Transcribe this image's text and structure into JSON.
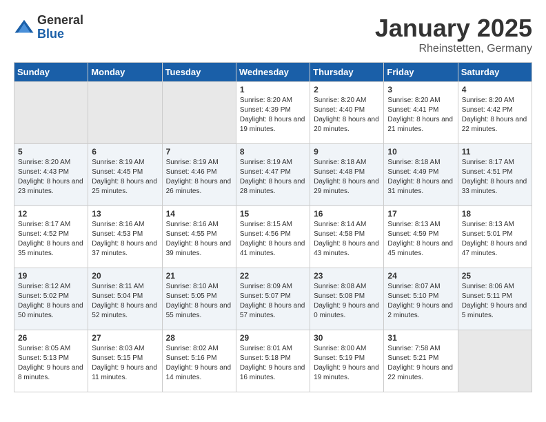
{
  "logo": {
    "general": "General",
    "blue": "Blue"
  },
  "header": {
    "title": "January 2025",
    "subtitle": "Rheinstetten, Germany"
  },
  "days_of_week": [
    "Sunday",
    "Monday",
    "Tuesday",
    "Wednesday",
    "Thursday",
    "Friday",
    "Saturday"
  ],
  "weeks": [
    [
      {
        "day": "",
        "empty": true
      },
      {
        "day": "",
        "empty": true
      },
      {
        "day": "",
        "empty": true
      },
      {
        "day": "1",
        "sunrise": "8:20 AM",
        "sunset": "4:39 PM",
        "daylight": "8 hours and 19 minutes."
      },
      {
        "day": "2",
        "sunrise": "8:20 AM",
        "sunset": "4:40 PM",
        "daylight": "8 hours and 20 minutes."
      },
      {
        "day": "3",
        "sunrise": "8:20 AM",
        "sunset": "4:41 PM",
        "daylight": "8 hours and 21 minutes."
      },
      {
        "day": "4",
        "sunrise": "8:20 AM",
        "sunset": "4:42 PM",
        "daylight": "8 hours and 22 minutes."
      }
    ],
    [
      {
        "day": "5",
        "sunrise": "8:20 AM",
        "sunset": "4:43 PM",
        "daylight": "8 hours and 23 minutes."
      },
      {
        "day": "6",
        "sunrise": "8:19 AM",
        "sunset": "4:45 PM",
        "daylight": "8 hours and 25 minutes."
      },
      {
        "day": "7",
        "sunrise": "8:19 AM",
        "sunset": "4:46 PM",
        "daylight": "8 hours and 26 minutes."
      },
      {
        "day": "8",
        "sunrise": "8:19 AM",
        "sunset": "4:47 PM",
        "daylight": "8 hours and 28 minutes."
      },
      {
        "day": "9",
        "sunrise": "8:18 AM",
        "sunset": "4:48 PM",
        "daylight": "8 hours and 29 minutes."
      },
      {
        "day": "10",
        "sunrise": "8:18 AM",
        "sunset": "4:49 PM",
        "daylight": "8 hours and 31 minutes."
      },
      {
        "day": "11",
        "sunrise": "8:17 AM",
        "sunset": "4:51 PM",
        "daylight": "8 hours and 33 minutes."
      }
    ],
    [
      {
        "day": "12",
        "sunrise": "8:17 AM",
        "sunset": "4:52 PM",
        "daylight": "8 hours and 35 minutes."
      },
      {
        "day": "13",
        "sunrise": "8:16 AM",
        "sunset": "4:53 PM",
        "daylight": "8 hours and 37 minutes."
      },
      {
        "day": "14",
        "sunrise": "8:16 AM",
        "sunset": "4:55 PM",
        "daylight": "8 hours and 39 minutes."
      },
      {
        "day": "15",
        "sunrise": "8:15 AM",
        "sunset": "4:56 PM",
        "daylight": "8 hours and 41 minutes."
      },
      {
        "day": "16",
        "sunrise": "8:14 AM",
        "sunset": "4:58 PM",
        "daylight": "8 hours and 43 minutes."
      },
      {
        "day": "17",
        "sunrise": "8:13 AM",
        "sunset": "4:59 PM",
        "daylight": "8 hours and 45 minutes."
      },
      {
        "day": "18",
        "sunrise": "8:13 AM",
        "sunset": "5:01 PM",
        "daylight": "8 hours and 47 minutes."
      }
    ],
    [
      {
        "day": "19",
        "sunrise": "8:12 AM",
        "sunset": "5:02 PM",
        "daylight": "8 hours and 50 minutes."
      },
      {
        "day": "20",
        "sunrise": "8:11 AM",
        "sunset": "5:04 PM",
        "daylight": "8 hours and 52 minutes."
      },
      {
        "day": "21",
        "sunrise": "8:10 AM",
        "sunset": "5:05 PM",
        "daylight": "8 hours and 55 minutes."
      },
      {
        "day": "22",
        "sunrise": "8:09 AM",
        "sunset": "5:07 PM",
        "daylight": "8 hours and 57 minutes."
      },
      {
        "day": "23",
        "sunrise": "8:08 AM",
        "sunset": "5:08 PM",
        "daylight": "9 hours and 0 minutes."
      },
      {
        "day": "24",
        "sunrise": "8:07 AM",
        "sunset": "5:10 PM",
        "daylight": "9 hours and 2 minutes."
      },
      {
        "day": "25",
        "sunrise": "8:06 AM",
        "sunset": "5:11 PM",
        "daylight": "9 hours and 5 minutes."
      }
    ],
    [
      {
        "day": "26",
        "sunrise": "8:05 AM",
        "sunset": "5:13 PM",
        "daylight": "9 hours and 8 minutes."
      },
      {
        "day": "27",
        "sunrise": "8:03 AM",
        "sunset": "5:15 PM",
        "daylight": "9 hours and 11 minutes."
      },
      {
        "day": "28",
        "sunrise": "8:02 AM",
        "sunset": "5:16 PM",
        "daylight": "9 hours and 14 minutes."
      },
      {
        "day": "29",
        "sunrise": "8:01 AM",
        "sunset": "5:18 PM",
        "daylight": "9 hours and 16 minutes."
      },
      {
        "day": "30",
        "sunrise": "8:00 AM",
        "sunset": "5:19 PM",
        "daylight": "9 hours and 19 minutes."
      },
      {
        "day": "31",
        "sunrise": "7:58 AM",
        "sunset": "5:21 PM",
        "daylight": "9 hours and 22 minutes."
      },
      {
        "day": "",
        "empty": true
      }
    ]
  ]
}
